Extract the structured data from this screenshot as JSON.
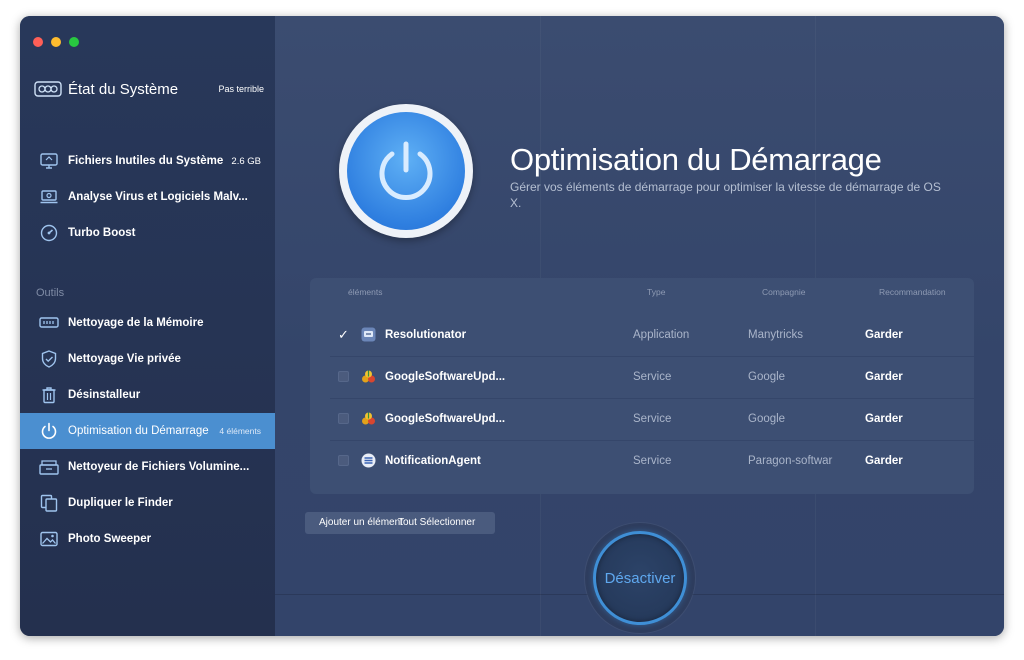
{
  "window": {
    "traffic_lights": [
      "#ff5f57",
      "#febc2e",
      "#28c840"
    ]
  },
  "sidebar": {
    "header": {
      "title": "État du Système",
      "status": "Pas terrible",
      "icon": "gauge-icon"
    },
    "top_items": [
      {
        "label": "Fichiers Inutiles du Système",
        "meta": "2.6 GB",
        "icon": "monitor-trash-icon"
      },
      {
        "label": "Analyse Virus et Logiciels Malv...",
        "meta": "",
        "icon": "laptop-scan-icon"
      },
      {
        "label": "Turbo Boost",
        "meta": "",
        "icon": "speedometer-icon"
      }
    ],
    "section_label": "Outils",
    "tool_items": [
      {
        "label": "Nettoyage de la Mémoire",
        "meta": "",
        "icon": "memory-icon"
      },
      {
        "label": "Nettoyage Vie privée",
        "meta": "",
        "icon": "shield-icon"
      },
      {
        "label": "Désinstalleur",
        "meta": "",
        "icon": "trash-icon"
      },
      {
        "label": "Optimisation du Démarrage",
        "meta": "4 éléments",
        "icon": "power-icon",
        "active": true
      },
      {
        "label": "Nettoyeur de Fichiers Volumine...",
        "meta": "",
        "icon": "file-cabinet-icon"
      },
      {
        "label": "Dupliquer le Finder",
        "meta": "",
        "icon": "duplicate-icon"
      },
      {
        "label": "Photo Sweeper",
        "meta": "",
        "icon": "photo-icon"
      }
    ],
    "active_color": "#4b8fd0"
  },
  "main": {
    "hero": {
      "title": "Optimisation du Démarrage",
      "description": "Gérer vos éléments de démarrage pour optimiser la vitesse de démarrage de OS X.",
      "icon": "power-icon"
    },
    "table": {
      "columns": [
        "éléments",
        "Type",
        "Compagnie",
        "Recommandation"
      ],
      "rows": [
        {
          "checked": true,
          "name": "Resolutionator",
          "type": "Application",
          "company": "Manytricks",
          "recommendation": "Garder",
          "icon": "resolutionator-app-icon"
        },
        {
          "checked": false,
          "name": "GoogleSoftwareUpd...",
          "type": "Service",
          "company": "Google",
          "recommendation": "Garder",
          "icon": "google-update-icon"
        },
        {
          "checked": false,
          "name": "GoogleSoftwareUpd...",
          "type": "Service",
          "company": "Google",
          "recommendation": "Garder",
          "icon": "google-update-icon"
        },
        {
          "checked": false,
          "name": "NotificationAgent",
          "type": "Service",
          "company": "Paragon-softwar",
          "recommendation": "Garder",
          "icon": "notification-agent-icon"
        }
      ]
    },
    "buttons": {
      "add_item": "Ajouter un élément",
      "select_all": "Tout Sélectionner"
    },
    "action": {
      "label": "Désactiver",
      "accent": "#3f8fd6"
    }
  }
}
